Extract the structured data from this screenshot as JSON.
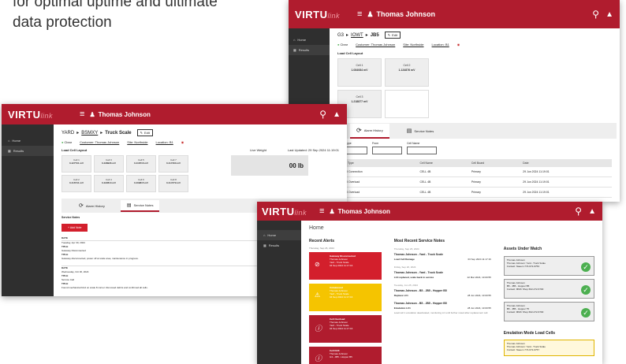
{
  "tagline": {
    "line1": "for optimal uptime and ultimate",
    "line2": "data protection"
  },
  "brand": {
    "name": "VIRTU",
    "suffix": "link"
  },
  "colors": {
    "brand_red": "#b01c2e",
    "sidebar": "#2f2f2f",
    "alert_red": "#d31f2c",
    "alert_yellow": "#f5c400",
    "ok_green": "#4caf50"
  },
  "sidebar": {
    "home": "Home",
    "results": "Results"
  },
  "win1": {
    "user": "Thomas Johnson",
    "crumbs": [
      "G3",
      "IOWT",
      "JB5"
    ],
    "edit": "Edit",
    "status": "Clear",
    "links": [
      "Customer: Thomas Johnson",
      "Site: Northside",
      "Location: B1"
    ],
    "layout_title": "Load Cell Layout",
    "cells": [
      {
        "name": "Cell 1",
        "value": "1.084084 mV"
      },
      {
        "name": "Cell 2",
        "value": "1.124876 mV"
      },
      {
        "name": "Cell 3",
        "value": "1.218877 mV"
      }
    ],
    "tabs": [
      "Alarm History",
      "Service Notes"
    ],
    "filter_labels": [
      "Alarm Type",
      "From",
      "Cell Name"
    ],
    "table_headers": [
      "Alarm Type",
      "Cell Name",
      "Cell Board",
      "Date"
    ],
    "rows": [
      {
        "type": "Cell Connection",
        "cell": "CELL 4B",
        "board": "Primary",
        "date": "29 Jun 2024 11:19:01"
      },
      {
        "type": "Cell Overload",
        "cell": "CELL 4B",
        "board": "Primary",
        "date": "29 Jun 2024 11:19:01"
      },
      {
        "type": "Cell Overload",
        "cell": "CELL 4B",
        "board": "Primary",
        "date": "29 Jun 2024 11:19:01"
      }
    ]
  },
  "win2": {
    "user": "Thomas Johnson",
    "crumbs": [
      "YARD",
      "BSMXY",
      "Truck Scale"
    ],
    "edit": "Edit",
    "status": "Clear",
    "links": [
      "Customer: Thomas Johnson",
      "Site: Northside",
      "Location: B1"
    ],
    "layout_title": "Load Cell Layout",
    "live_weight_label": "Live Weight",
    "last_updated": "Last Updated: 29 Sep 2024 11:19:01",
    "weight": "00 lb",
    "cells": [
      {
        "name": "Cell 1",
        "value": "0.427731 mV"
      },
      {
        "name": "Cell 3",
        "value": "0.438936 mV"
      },
      {
        "name": "Cell 5",
        "value": "0.418716 mV"
      },
      {
        "name": "Cell 7",
        "value": "0.417463 mV"
      },
      {
        "name": "Cell 2",
        "value": "0.416741 mV"
      },
      {
        "name": "Cell 4",
        "value": "0.422813 mV"
      },
      {
        "name": "Cell 6",
        "value": "0.409815 mV"
      },
      {
        "name": "Cell 8",
        "value": "0.414779 mV"
      }
    ],
    "tabs": [
      "Alarm History",
      "Service Notes"
    ],
    "notes_title": "Service Notes",
    "add_note": "Add Note",
    "date_header": "DATE",
    "created_header": "CREATED BY",
    "notes": [
      {
        "date": "Tuesday, Apr 30, 2024",
        "title_label": "TITLE",
        "title": "Gateway Disconnected",
        "details_label": "TITLE",
        "details": "Gateway disconnected, power off at scale area, maintenance in progress."
      },
      {
        "date": "Wednesday, Oct 30, 2024",
        "title_label": "TITLE",
        "title": "Service Call",
        "details_label": "TITLE",
        "details": "Found mechanical bind on scale 8 corner. Removed debris and confirmed all cells."
      }
    ]
  },
  "win3": {
    "user": "Thomas Johnson",
    "page_title": "Home",
    "recent_alerts_title": "Recent Alerts",
    "recent_alerts_date": "Thursday, Sep 26, 2024",
    "alerts": [
      {
        "title": "Gateway Disconnected",
        "line1": "Thomas Johnson",
        "line2": "Yard - Truck Scale",
        "line3": "04 Sep 2024 11:17:16",
        "color": "#d31f2c",
        "icon": "no-signal-icon"
      },
      {
        "title": "Unbalanced",
        "line1": "Thomas Johnson",
        "line2": "Yard - Truck Scale",
        "line3": "04 Sep 2024 11:17:16",
        "color": "#f5c400",
        "icon": "warning-icon"
      },
      {
        "title": "Cell Overload",
        "line1": "Thomas Johnson",
        "line2": "Yard - Truck Scale",
        "line3": "04 Sep 2024 11:17:16",
        "color": "#b01c2e",
        "icon": "info-icon"
      },
      {
        "title": "Cell Drift",
        "line1": "Thomas Johnson",
        "line2": "G3 - JB5 - Hopper B5",
        "line3": "",
        "color": "#b01c2e",
        "icon": "info-icon"
      }
    ],
    "notes_title": "Most Recent Service Notes",
    "service_notes": [
      {
        "date": "Thursday, Sep 26, 2024",
        "title": "Thomas Johnson - Yard - Truck Scale",
        "sub": "Load Cell Damage",
        "stamp": "03 Sep 2024 11:17:16",
        "desc": ""
      },
      {
        "date": "Friday, Sep 20, 2024",
        "title": "Thomas Johnson - Yard - Truck Scale",
        "sub": "LC4 replaced, scale back in service",
        "stamp": "22 Mar 2024, 13:00:55",
        "desc": ""
      },
      {
        "date": "Tuesday, Jun 25, 2024",
        "title": "Thomas Johnson - B5 - JB5 - Hopper B5",
        "sub": "Replace LC1",
        "stamp": "28 Jun 2024, 13:00:55",
        "desc": ""
      },
      {
        "date": "",
        "title": "Thomas Johnson - B5 - JB5 - Hopper B5",
        "sub": "Emulation LC1",
        "stamp": "28 Jun 2024, 13:00:55",
        "desc": "Load cell 1 emulation deactivated, monitoring LC until further noted after replacement cell."
      }
    ],
    "watch_title": "Assets Under Watch",
    "watch": [
      {
        "l1": "Thomas Johnson",
        "l2": "Thomas Johnson: Yard - Truck Scale",
        "l3": "Contact: Naeem 774-672-6753"
      },
      {
        "l1": "Thomas Johnson",
        "l2": "B5 - JB5 - Hopper B5",
        "l3": "Contact: MMC Shop 602-272-6700"
      },
      {
        "l1": "Thomas Johnson",
        "l2": "B5 - JB5 - Hopper T5",
        "l3": "Contact: MMC Shop 602-272-6700"
      }
    ],
    "emul_title": "Emulation Mode Load Cells",
    "emul": {
      "l1": "Thomas Johnson",
      "l2": "Thomas Johnson: Yard - Truck Scale",
      "l3": "Contact: Naeem 774-672-6757"
    }
  }
}
